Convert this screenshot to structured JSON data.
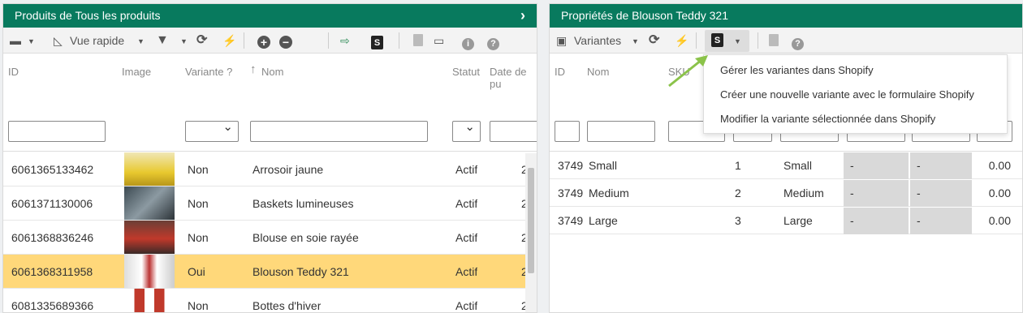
{
  "left": {
    "title": "Produits de Tous les produits",
    "chevron": "›",
    "toolbar": {
      "view_label": "Vue rapide"
    },
    "columns": [
      "ID",
      "Image",
      "Variante ?",
      "Nom",
      "Statut",
      "Date de pu"
    ],
    "sort_arrow": "↑",
    "rows": [
      {
        "id": "6061365133462",
        "variant": "Non",
        "name": "Arrosoir jaune",
        "status": "Actif",
        "date": "2"
      },
      {
        "id": "6061371130006",
        "variant": "Non",
        "name": "Baskets lumineuses",
        "status": "Actif",
        "date": "2"
      },
      {
        "id": "6061368836246",
        "variant": "Non",
        "name": "Blouse en soie rayée",
        "status": "Actif",
        "date": "2"
      },
      {
        "id": "6061368311958",
        "variant": "Oui",
        "name": "Blouson Teddy 321",
        "status": "Actif",
        "date": "2"
      },
      {
        "id": "6081335689366",
        "variant": "Non",
        "name": "Bottes d'hiver",
        "status": "Actif",
        "date": "2"
      }
    ]
  },
  "right": {
    "title": "Propriétés de Blouson Teddy 321",
    "toolbar": {
      "view_label": "Variantes"
    },
    "columns": [
      "ID",
      "Nom",
      "SKU"
    ],
    "rows": [
      {
        "id": "3749",
        "name": "Small",
        "num": "1",
        "option": "Small",
        "c1": "-",
        "c2": "-",
        "price": "0.00"
      },
      {
        "id": "3749",
        "name": "Medium",
        "num": "2",
        "option": "Medium",
        "c1": "-",
        "c2": "-",
        "price": "0.00"
      },
      {
        "id": "3749",
        "name": "Large",
        "num": "3",
        "option": "Large",
        "c1": "-",
        "c2": "-",
        "price": "0.00"
      }
    ]
  },
  "dropdown": {
    "items": [
      "Gérer les variantes dans Shopify",
      "Créer une nouvelle variante avec le formulaire Shopify",
      "Modifier la variante sélectionnée dans Shopify"
    ]
  },
  "colors": {
    "titlebar": "#087a5e",
    "selected_row": "#ffd87a",
    "arrow": "#8bc34a"
  }
}
